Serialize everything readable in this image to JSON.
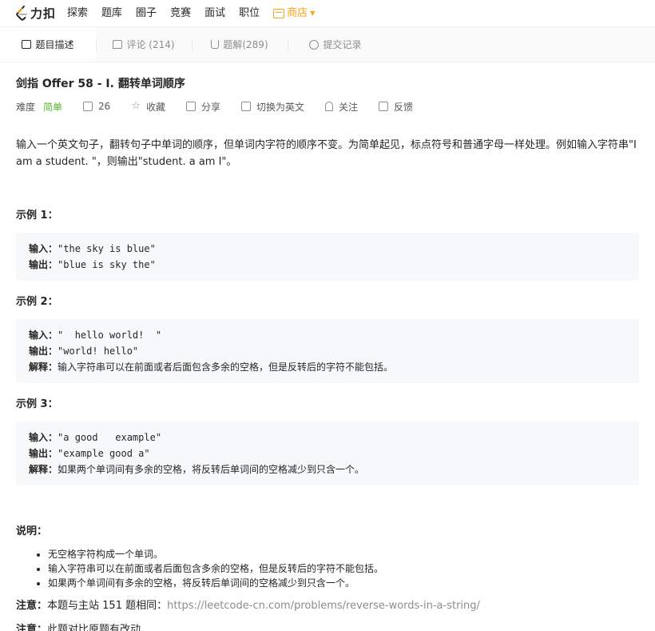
{
  "brand": {
    "name": "力扣",
    "logo_icon": "leetcode-logo-icon"
  },
  "nav": {
    "items": [
      "探索",
      "题库",
      "圈子",
      "竞赛",
      "面试",
      "职位"
    ],
    "store": "商店"
  },
  "tabs": [
    {
      "label": "题目描述",
      "icon": "document-icon"
    },
    {
      "label": "评论 (214)",
      "icon": "comment-icon"
    },
    {
      "label": "题解(289)",
      "icon": "flask-icon"
    },
    {
      "label": "提交记录",
      "icon": "clock-icon"
    }
  ],
  "problem": {
    "title": "剑指 Offer 58 - I. 翻转单词顺序",
    "difficulty_label": "难度",
    "difficulty": "简单",
    "likes": "26",
    "actions": {
      "favorite": "收藏",
      "share": "分享",
      "translate": "切换为英文",
      "follow": "关注",
      "feedback": "反馈"
    },
    "description": "输入一个英文句子，翻转句子中单词的顺序，但单词内字符的顺序不变。为简单起见，标点符号和普通字母一样处理。例如输入字符串\"I am a student. \"，则输出\"student. a am I\"。",
    "examples": [
      {
        "title": "示例 1：",
        "input_label": "输入：",
        "input": "\"the sky is blue\"",
        "output_label": "输出：",
        "output": "\"blue is sky the\""
      },
      {
        "title": "示例 2：",
        "input_label": "输入：",
        "input": "\"  hello world!  \"",
        "output_label": "输出：",
        "output": "\"world! hello\"",
        "explain_label": "解释：",
        "explain": "输入字符串可以在前面或者后面包含多余的空格，但是反转后的字符不能包括。"
      },
      {
        "title": "示例 3：",
        "input_label": "输入：",
        "input": "\"a good   example\"",
        "output_label": "输出：",
        "output": "\"example good a\"",
        "explain_label": "解释：",
        "explain": "如果两个单词间有多余的空格，将反转后单词间的空格减少到只含一个。"
      }
    ],
    "notes_title": "说明：",
    "notes": [
      "无空格字符构成一个单词。",
      "输入字符串可以在前面或者后面包含多余的空格，但是反转后的字符不能包括。",
      "如果两个单词间有多余的空格，将反转后单词间的空格减少到只含一个。"
    ],
    "note1_label": "注意：",
    "note1_text": "本题与主站 151 题相同：",
    "note1_link": "https://leetcode-cn.com/problems/reverse-words-in-a-string/",
    "note2_label": "注意：",
    "note2_text": "此题对比原题有改动"
  },
  "colors": {
    "accent": "#ffa116",
    "easy": "#5ab726",
    "muted": "#8c8c8c",
    "code_bg": "#f7f8fa"
  }
}
